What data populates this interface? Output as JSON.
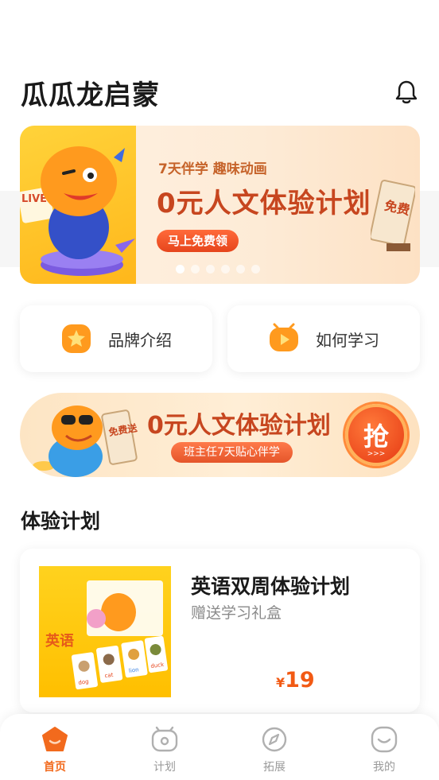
{
  "header": {
    "title": "瓜瓜龙启蒙"
  },
  "banner": {
    "subtitle": "7天伴学 趣味动画",
    "title": "0元人文体验计划",
    "button": "马上免费领",
    "art_text": "LIVE",
    "scroll_text": "免费",
    "active_slide": 1,
    "slide_count": 6
  },
  "entries": [
    {
      "label": "品牌介绍",
      "icon": "star-badge-icon"
    },
    {
      "label": "如何学习",
      "icon": "play-tv-icon"
    }
  ],
  "promo": {
    "title": "0元人文体验计划",
    "subtitle": "班主任7天贴心伴学",
    "grab": "抢",
    "arrows": ">>>",
    "scroll_text": "免费送"
  },
  "section": {
    "title": "体验计划"
  },
  "plan": {
    "name": "英语双周体验计划",
    "gift": "赠送学习礼盒",
    "currency": "¥",
    "price": "19",
    "box_text": "英语",
    "cards": [
      "dog",
      "cat",
      "lion",
      "duck"
    ]
  },
  "tabs": [
    {
      "label": "首页",
      "icon": "home-icon",
      "active": true
    },
    {
      "label": "计划",
      "icon": "tv-icon",
      "active": false
    },
    {
      "label": "拓展",
      "icon": "compass-icon",
      "active": false
    },
    {
      "label": "我的",
      "icon": "smile-icon",
      "active": false
    }
  ],
  "colors": {
    "accent": "#f26a1d",
    "promo_red": "#c7461f",
    "price": "#f25a14"
  }
}
